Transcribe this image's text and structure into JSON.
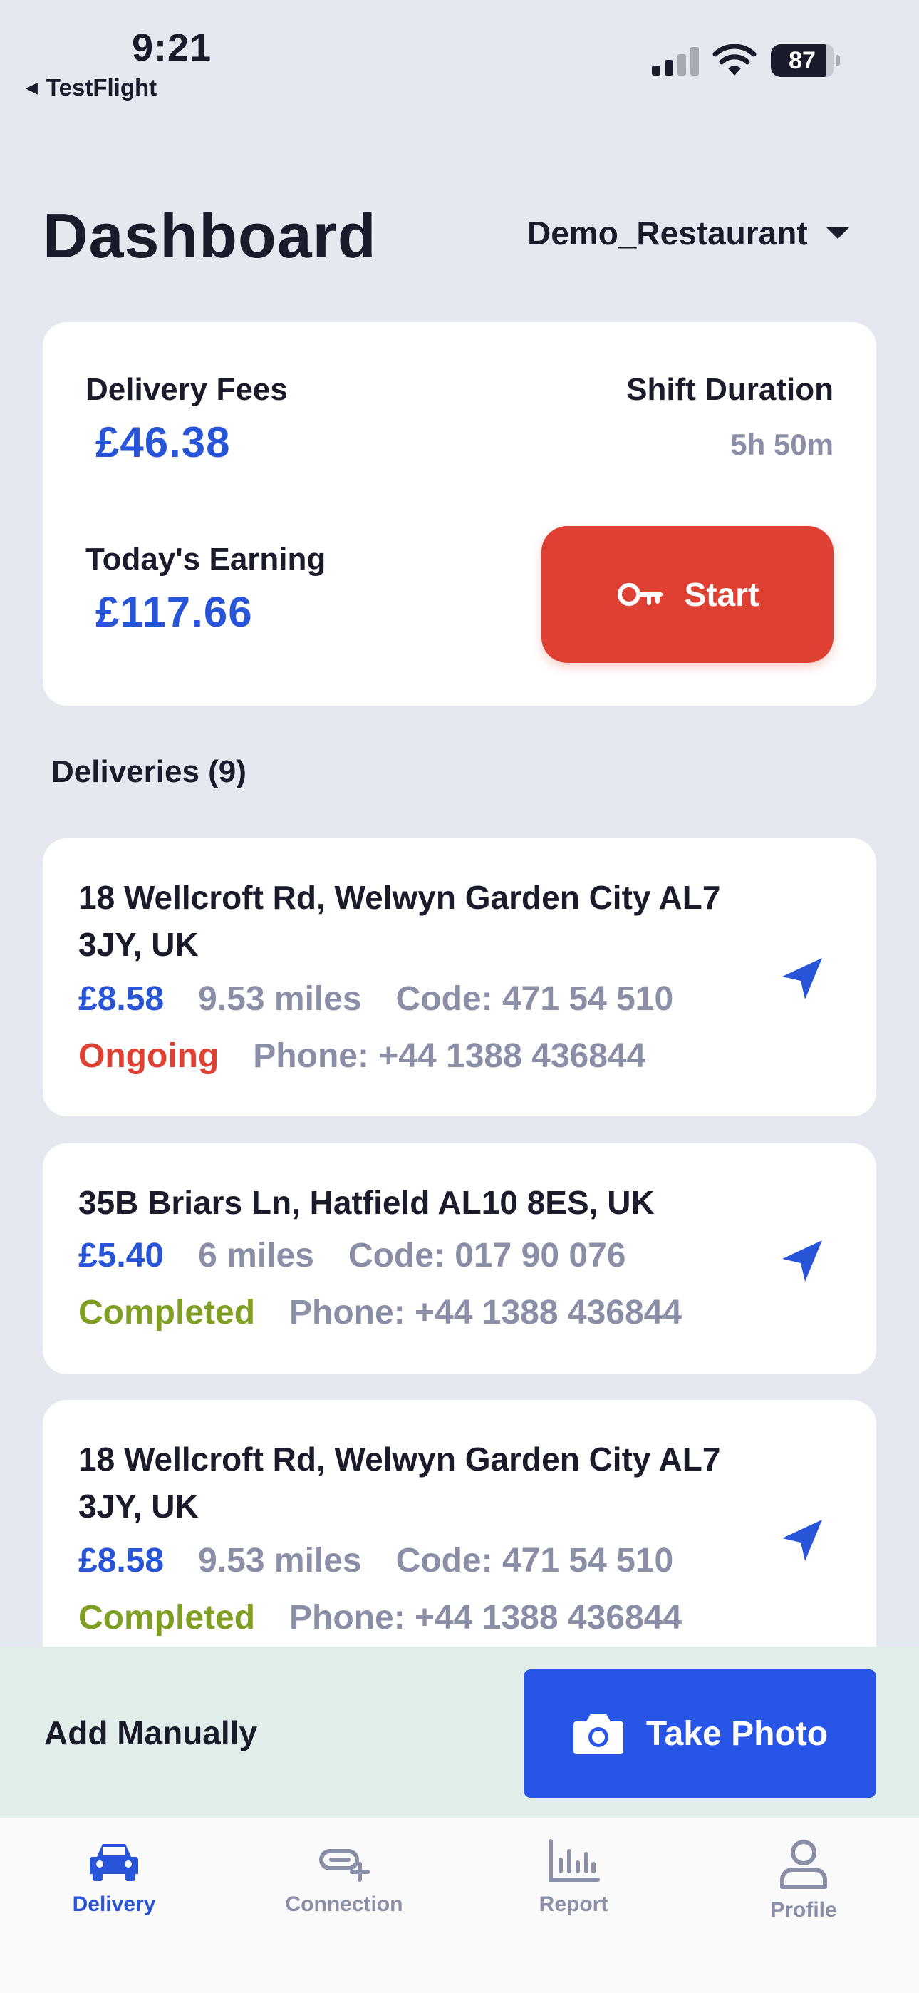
{
  "status_bar": {
    "time": "9:21",
    "back_label": "TestFlight",
    "battery": "87"
  },
  "header": {
    "title": "Dashboard",
    "restaurant": "Demo_Restaurant"
  },
  "summary": {
    "delivery_fees_label": "Delivery Fees",
    "delivery_fees_value": "£46.38",
    "shift_duration_label": "Shift Duration",
    "shift_duration_value": "5h 50m",
    "earning_label": "Today's Earning",
    "earning_value": "£117.66",
    "start_label": "Start"
  },
  "deliveries": {
    "title": "Deliveries (9)",
    "items": [
      {
        "address": "18 Wellcroft Rd, Welwyn Garden City AL7 3JY, UK",
        "price": "£8.58",
        "miles": "9.53 miles",
        "code": "Code: 471 54 510",
        "status": "Ongoing",
        "phone": "Phone: +44 1388 436844"
      },
      {
        "address": "35B Briars Ln, Hatfield AL10 8ES, UK",
        "price": "£5.40",
        "miles": "6 miles",
        "code": "Code: 017 90 076",
        "status": "Completed",
        "phone": "Phone: +44 1388 436844"
      },
      {
        "address": "18 Wellcroft Rd, Welwyn Garden City AL7 3JY, UK",
        "price": "£8.58",
        "miles": "9.53 miles",
        "code": "Code: 471 54 510",
        "status": "Completed",
        "phone": "Phone: +44 1388 436844"
      }
    ]
  },
  "actions": {
    "add_manually": "Add Manually",
    "take_photo": "Take Photo"
  },
  "tabs": [
    {
      "label": "Delivery",
      "icon": "car-icon",
      "active": true
    },
    {
      "label": "Connection",
      "icon": "link-add-icon",
      "active": false
    },
    {
      "label": "Report",
      "icon": "bar-chart-icon",
      "active": false
    },
    {
      "label": "Profile",
      "icon": "user-icon",
      "active": false
    }
  ],
  "colors": {
    "accent_blue": "#2855d8",
    "start_red": "#de4133",
    "completed_green": "#7f9f22",
    "background": "#e6e8f0"
  }
}
